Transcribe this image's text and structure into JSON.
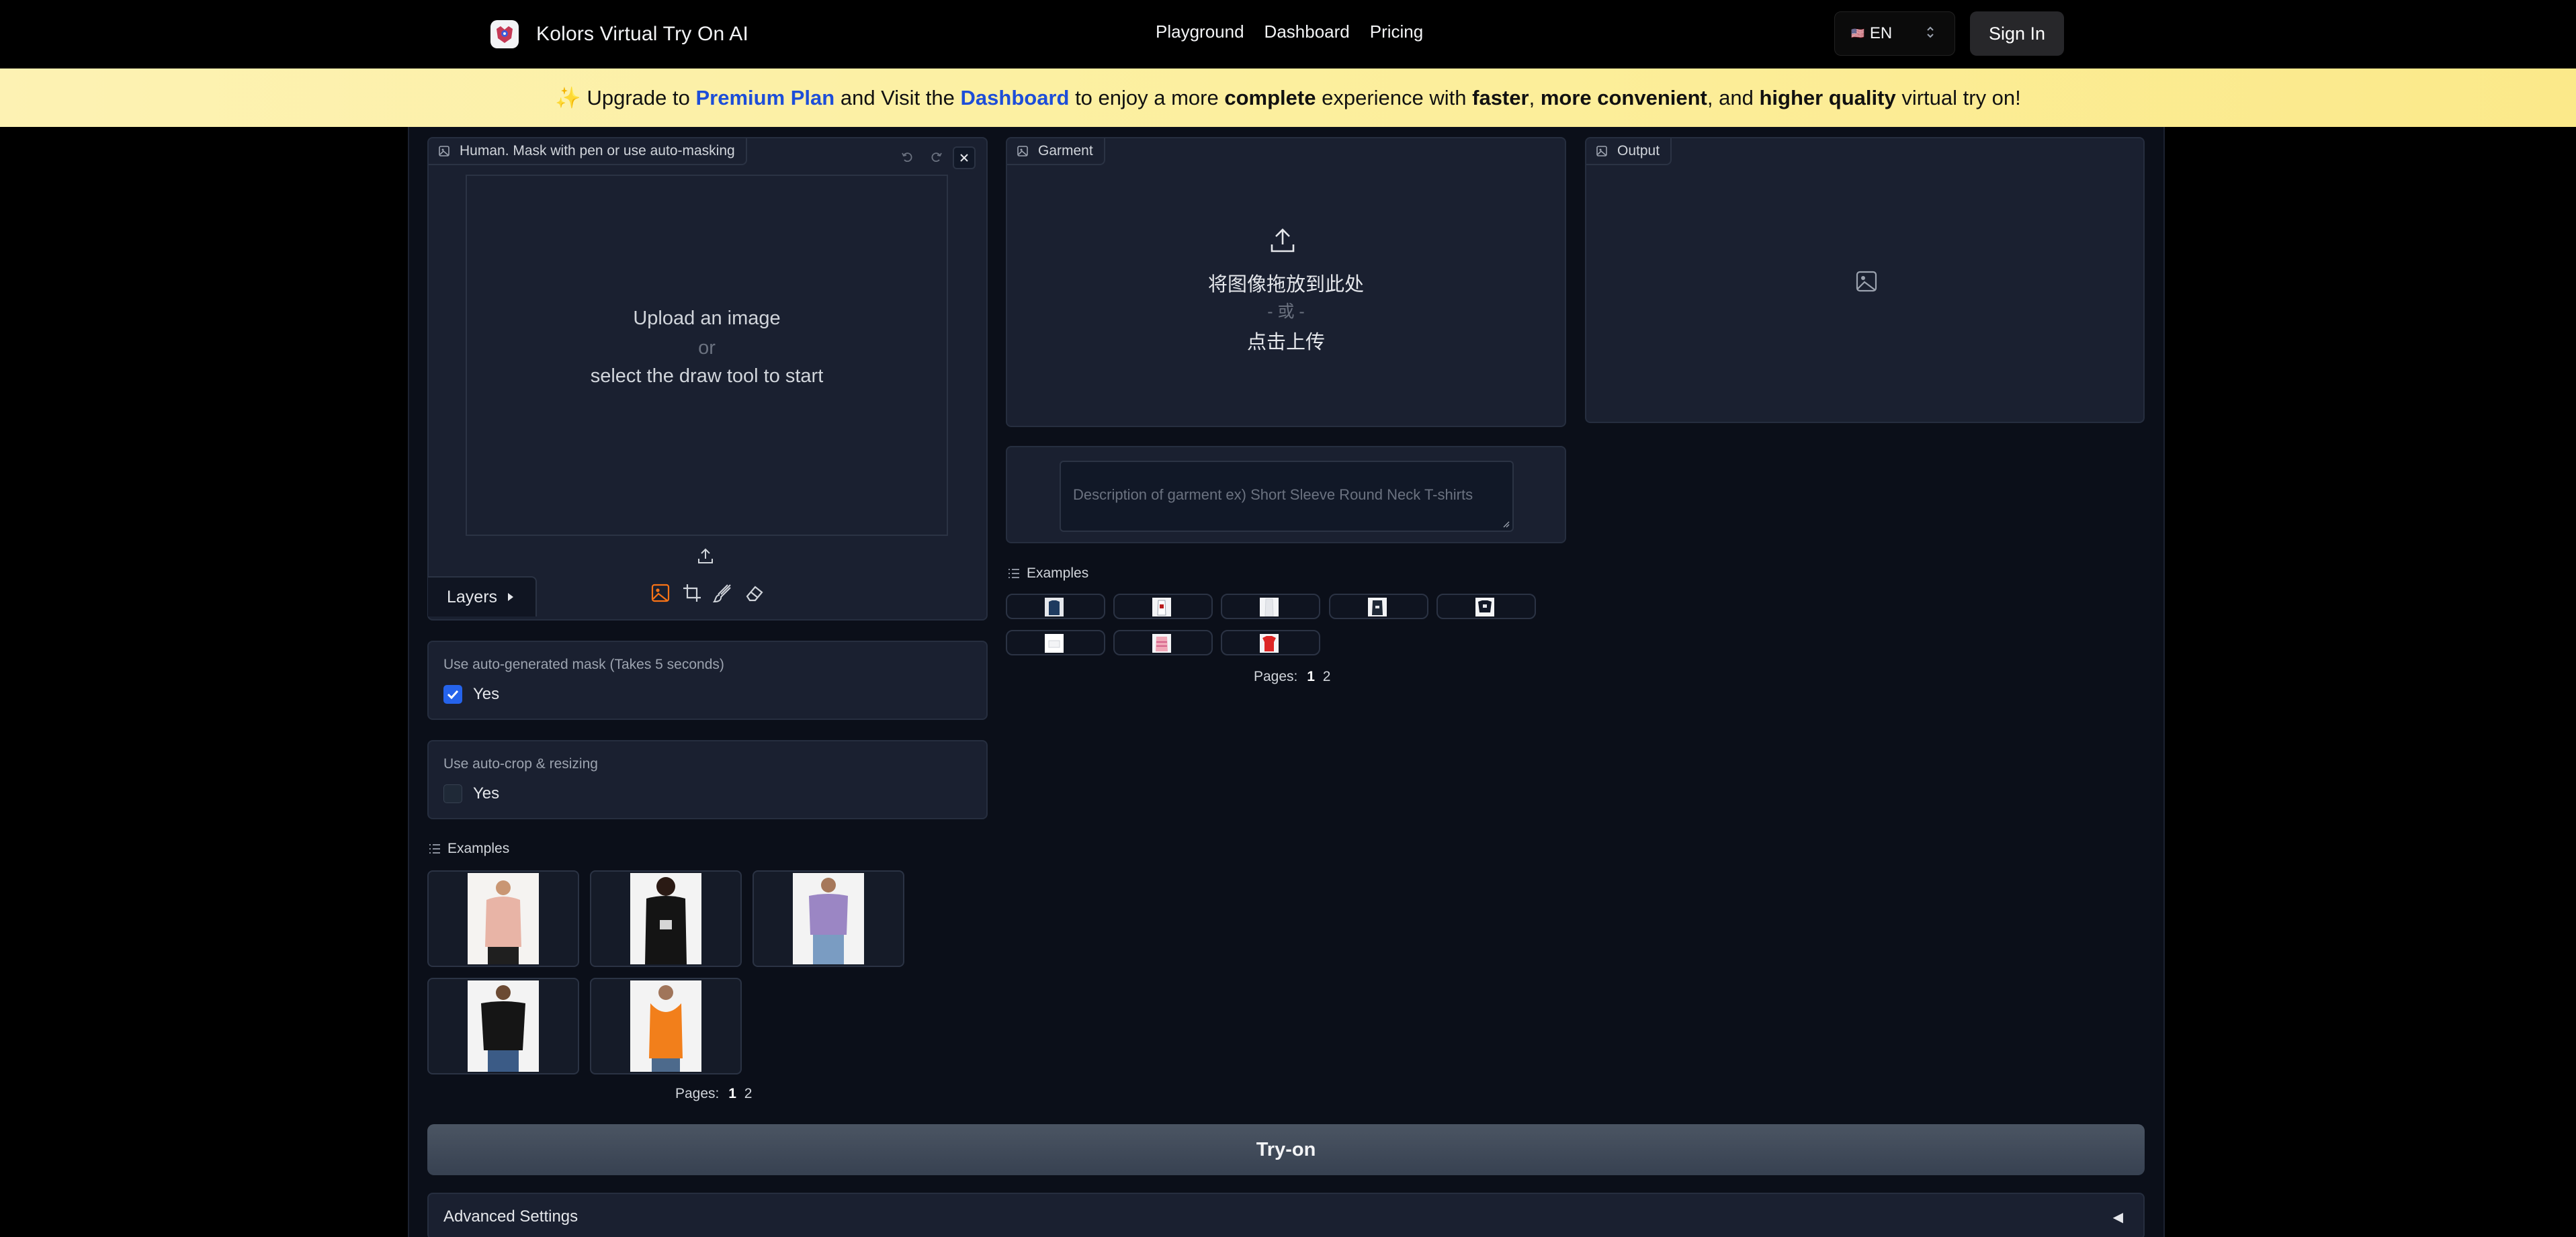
{
  "navbar": {
    "brand_title": "Kolors Virtual Try On AI",
    "links": [
      "Playground",
      "Dashboard",
      "Pricing"
    ],
    "language": "EN",
    "flag": "🇺🇸",
    "sign_in": "Sign In"
  },
  "banner": {
    "sparkle": "✨",
    "t1": "Upgrade to",
    "l1": "Premium Plan",
    "t2": "and Visit the",
    "l2": "Dashboard",
    "t3": "to enjoy a more",
    "b1": "complete",
    "t4": "experience with",
    "b2": "faster",
    "t5": ",",
    "b3": "more convenient",
    "t6": ", and",
    "b4": "higher quality",
    "t7": "virtual try on!"
  },
  "human": {
    "label": "Human. Mask with pen or use auto-masking",
    "upload_line1": "Upload an image",
    "upload_or": "or",
    "upload_line2": "select the draw tool to start",
    "layers": "Layers"
  },
  "garment": {
    "label": "Garment",
    "drop_text": "将图像拖放到此处",
    "or_text": "- 或 -",
    "click_text": "点击上传",
    "description_placeholder": "Description of garment ex) Short Sleeve Round Neck T-shirts"
  },
  "output": {
    "label": "Output"
  },
  "auto_mask": {
    "label": "Use auto-generated mask (Takes 5 seconds)",
    "option": "Yes",
    "checked": true
  },
  "auto_crop": {
    "label": "Use auto-crop & resizing",
    "option": "Yes",
    "checked": false
  },
  "garment_examples": {
    "title": "Examples",
    "pages_label": "Pages:",
    "pages": [
      "1",
      "2"
    ]
  },
  "human_examples": {
    "title": "Examples",
    "pages_label": "Pages:",
    "pages": [
      "1",
      "2"
    ]
  },
  "try_on": "Try-on",
  "advanced": {
    "label": "Advanced Settings",
    "toggle": "◀"
  },
  "colors": {
    "accent_orange": "#f97316",
    "check_blue": "#2563eb",
    "link_blue": "#1d4ed8"
  }
}
